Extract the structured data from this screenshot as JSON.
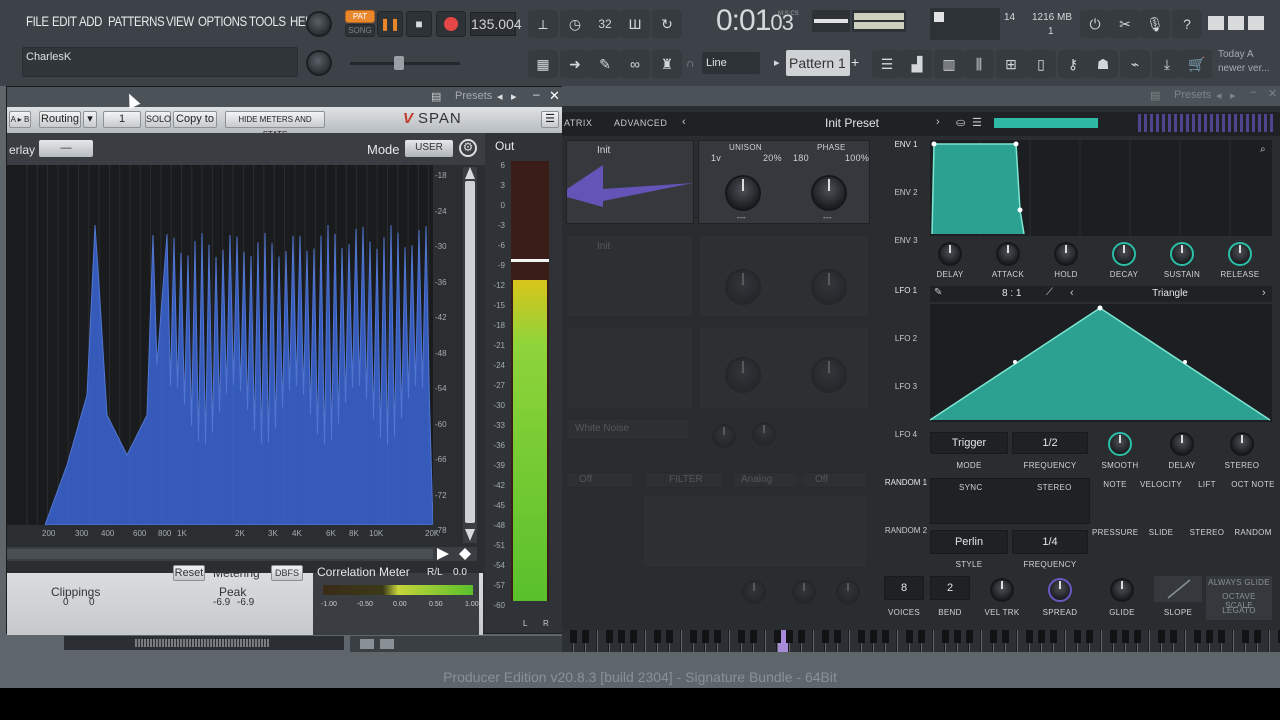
{
  "menubar": {
    "items": [
      "FILE",
      "EDIT",
      "ADD",
      "PATTERNS",
      "VIEW",
      "OPTIONS",
      "TOOLS",
      "HELP"
    ]
  },
  "transport": {
    "pat_label": "PAT",
    "song_label": "SONG",
    "tempo": "135.004",
    "time": "0:01",
    "time_ticks": "03",
    "time_unit": "M:S:CS",
    "step_label": "32",
    "cpu": "14",
    "memory": "1216 MB",
    "voices": "1"
  },
  "hint_bar": {
    "text": "CharlesK"
  },
  "toolbar2": {
    "snap": "Line",
    "pattern": "Pattern 1",
    "pattern_add": "+",
    "news_line1": "Today A",
    "news_line2": "newer ver..."
  },
  "span": {
    "title": "Presets",
    "buttons": {
      "ab": "A ▸ B",
      "routing": "Routing",
      "channel": "1",
      "solo": "SOLO",
      "copy_to": "Copy to",
      "hide_meters": "HIDE METERS AND STATS"
    },
    "logo": "SPAN",
    "overlay_label": "erlay",
    "overlay_value": "—",
    "mode_label": "Mode",
    "mode_value": "USER",
    "out_label": "Out",
    "db_scale": [
      "-18",
      "-24",
      "-30",
      "-36",
      "-42",
      "-48",
      "-54",
      "-60",
      "-66",
      "-72",
      "-78"
    ],
    "freq_labels": [
      "200",
      "300",
      "400",
      "600",
      "800",
      "1K",
      "2K",
      "3K",
      "4K",
      "6K",
      "8K",
      "10K",
      "20K"
    ],
    "meter_scale": [
      "6",
      "3",
      "0",
      "-3",
      "-6",
      "-9",
      "-12",
      "-15",
      "-18",
      "-21",
      "-24",
      "-27",
      "-30",
      "-33",
      "-36",
      "-39",
      "-42",
      "-45",
      "-48",
      "-51",
      "-54",
      "-57",
      "-60"
    ],
    "meter_lr": [
      "L",
      "R"
    ],
    "peak_level": 0.73,
    "footer": {
      "clippings_label": "Clippings",
      "clip_l": "0",
      "clip_r": "0",
      "reset": "Reset",
      "metering_label": "Metering",
      "metering_value": "DBFS",
      "peak_label": "Peak",
      "peak_l": "-6.9",
      "peak_r": "-6.9",
      "corr_label": "Correlation Meter",
      "rl": "R/L",
      "rl_value": "0.0",
      "corr_scale": [
        "-1.00",
        "-0.50",
        "0.00",
        "0.50",
        "1.00"
      ]
    }
  },
  "synth": {
    "title": "Presets",
    "tabs": [
      "ATRIX",
      "ADVANCED"
    ],
    "preset_name": "Init Preset",
    "osc_a": {
      "wavetable": "Init",
      "unison_label": "UNISON",
      "unison_voices": "1v",
      "unison_detune": "20%",
      "phase_label": "PHASE",
      "phase_value": "180",
      "phase_rand": "100%",
      "foot_a": "---",
      "foot_b": "---"
    },
    "dim_labels": {
      "osc_b_wt": "Init",
      "noise": "White Noise",
      "fx": [
        "Off",
        "FILTER",
        "Analog",
        "Off"
      ]
    },
    "env": {
      "tabs": [
        "ENV 1",
        "ENV 2",
        "ENV 3"
      ],
      "knobs": [
        "DELAY",
        "ATTACK",
        "HOLD",
        "DECAY",
        "SUSTAIN",
        "RELEASE"
      ]
    },
    "lfo": {
      "tabs": [
        "LFO 1",
        "LFO 2",
        "LFO 3",
        "LFO 4"
      ],
      "grid": "8 : 1",
      "shape": "Triangle",
      "trigger": "Trigger",
      "mode_label": "MODE",
      "rate": "1/2",
      "frequency_label": "FREQUENCY",
      "knobs": [
        "SMOOTH",
        "DELAY",
        "STEREO"
      ]
    },
    "random": {
      "tabs": [
        "RANDOM 1",
        "RANDOM 2"
      ],
      "sync": "SYNC",
      "stereo": "STEREO",
      "style_value": "Perlin",
      "style_label": "STYLE",
      "rate": "1/4",
      "frequency_label": "FREQUENCY"
    },
    "mod_sources": [
      "NOTE",
      "VELOCITY",
      "LIFT",
      "OCT NOTE",
      "PRESSURE",
      "SLIDE",
      "STEREO",
      "RANDOM"
    ],
    "voicing": {
      "voices": "8",
      "voices_label": "VOICES",
      "bend": "2",
      "bend_label": "BEND",
      "veltrk_label": "VEL TRK",
      "spread_label": "SPREAD",
      "glide_label": "GLIDE",
      "slope_label": "SLOPE",
      "always_glide": "ALWAYS GLIDE",
      "octave_scale": "OCTAVE SCALE",
      "legato": "LEGATO"
    }
  },
  "statusbar": {
    "text": "Producer Edition v20.8.3 [build 2304] - Signature Bundle - 64Bit"
  },
  "colors": {
    "accent": "#e9872c",
    "teal": "#2fb8a4",
    "spectrum": "#3a66d6",
    "meter": "#8fd43a"
  }
}
